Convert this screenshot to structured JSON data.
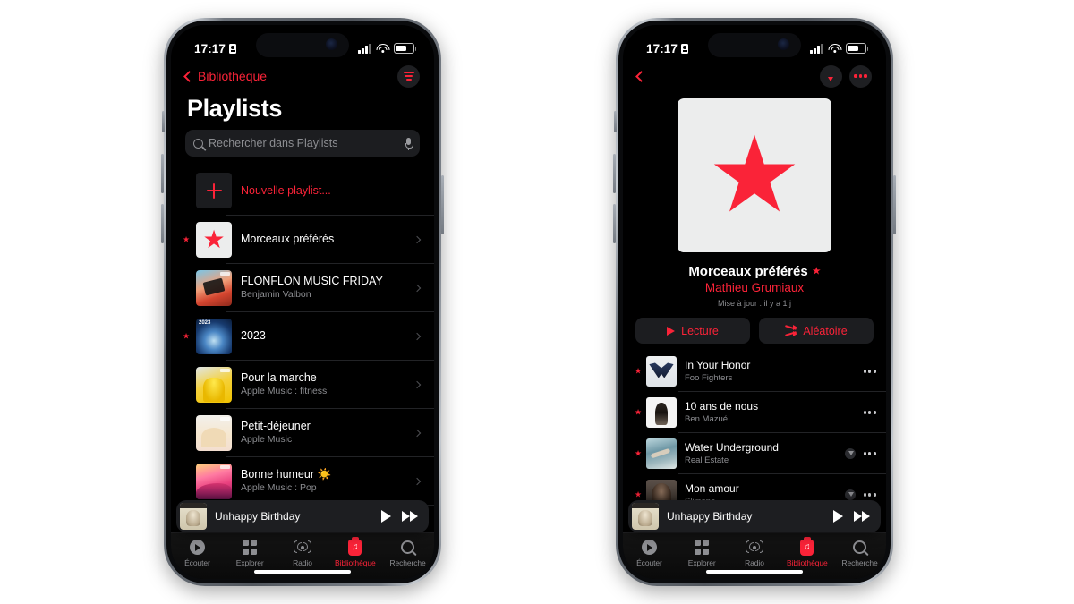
{
  "status_bar": {
    "time": "17:17",
    "recording_icon": "recording-indicator-icon",
    "signal_icon": "cellular-signal-icon",
    "wifi_icon": "wifi-icon",
    "battery_icon": "battery-icon"
  },
  "left_phone": {
    "nav": {
      "back_label": "Bibliothèque",
      "back_icon": "chevron-left-icon",
      "filter_icon": "filter-sort-icon"
    },
    "title": "Playlists",
    "search": {
      "placeholder": "Rechercher dans Playlists",
      "search_icon": "search-icon",
      "mic_icon": "microphone-icon"
    },
    "new_playlist": {
      "label": "Nouvelle playlist...",
      "icon": "plus-icon"
    },
    "playlists": [
      {
        "title": "Morceaux préférés",
        "subtitle": "",
        "art": "star-art",
        "starred": true
      },
      {
        "title": "FLONFLON MUSIC FRIDAY",
        "subtitle": "Benjamin Valbon",
        "art": "a-flon",
        "starred": false
      },
      {
        "title": "2023",
        "subtitle": "",
        "art": "a-2023",
        "starred": true
      },
      {
        "title": "Pour la marche",
        "subtitle": "Apple Music : fitness",
        "art": "a-marche",
        "starred": false
      },
      {
        "title": "Petit-déjeuner",
        "subtitle": "Apple Music",
        "art": "a-petit",
        "starred": false
      },
      {
        "title": "Bonne humeur ☀️",
        "subtitle": "Apple Music : Pop",
        "art": "a-bonne",
        "starred": false
      }
    ]
  },
  "right_phone": {
    "nav": {
      "back_icon": "chevron-left-icon",
      "download_icon": "download-icon",
      "more_icon": "more-options-icon"
    },
    "hero": {
      "artwork": "star-artwork",
      "title": "Morceaux préférés",
      "star_glyph": "★",
      "artist": "Mathieu Grumiaux",
      "updated": "Mise à jour : il y a 1 j"
    },
    "actions": {
      "play_label": "Lecture",
      "play_icon": "play-icon",
      "shuffle_label": "Aléatoire",
      "shuffle_icon": "shuffle-icon"
    },
    "tracks": [
      {
        "title": "In Your Honor",
        "artist": "Foo Fighters",
        "art": "a-foo",
        "starred": true,
        "downloadable": false
      },
      {
        "title": "10 ans de nous",
        "artist": "Ben Mazué",
        "art": "a-ben",
        "starred": true,
        "downloadable": false
      },
      {
        "title": "Water Underground",
        "artist": "Real Estate",
        "art": "a-water",
        "starred": true,
        "downloadable": true
      },
      {
        "title": "Mon amour",
        "artist": "Slimane",
        "art": "a-slimane",
        "starred": true,
        "downloadable": true
      }
    ]
  },
  "mini_player": {
    "title": "Unhappy Birthday",
    "play_icon": "play-icon",
    "next_icon": "fast-forward-icon",
    "art": "a-unhappy"
  },
  "tab_bar": [
    {
      "label": "Écouter",
      "icon": "listen-now-icon",
      "active": false
    },
    {
      "label": "Explorer",
      "icon": "browse-grid-icon",
      "active": false
    },
    {
      "label": "Radio",
      "icon": "radio-icon",
      "active": false
    },
    {
      "label": "Bibliothèque",
      "icon": "library-icon",
      "active": true
    },
    {
      "label": "Recherche",
      "icon": "search-icon",
      "active": false
    }
  ],
  "colors": {
    "accent": "#fa2338",
    "background": "#000000",
    "secondary_text": "#8d8e92",
    "page_background": "#ffffff"
  }
}
